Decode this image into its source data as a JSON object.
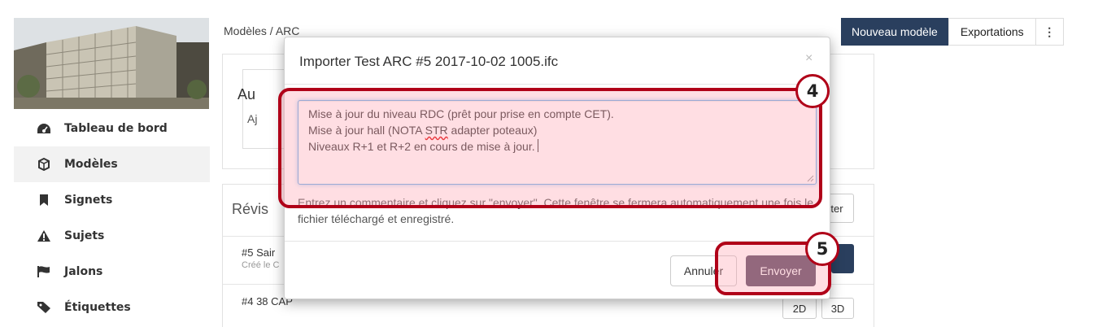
{
  "sidebar": {
    "items": [
      {
        "label": "Tableau de bord",
        "icon": "dashboard-icon"
      },
      {
        "label": "Modèles",
        "icon": "cube-icon"
      },
      {
        "label": "Signets",
        "icon": "bookmark-icon"
      },
      {
        "label": "Sujets",
        "icon": "warning-icon"
      },
      {
        "label": "Jalons",
        "icon": "flag-icon"
      },
      {
        "label": "Étiquettes",
        "icon": "tag-icon"
      }
    ],
    "active_index": 1
  },
  "header": {
    "breadcrumb": "Modèles / ARC",
    "new_model": "Nouveau modèle",
    "exports": "Exportations",
    "more": "⋮"
  },
  "background": {
    "panel_title_partial": "Au",
    "panel_sub_partial": "Aj",
    "revisions_title_partial": "Révis",
    "import_button_partial": "ter",
    "rows": [
      {
        "title_partial": "#5 Sair",
        "meta_partial": "Créé le C"
      },
      {
        "title_partial": "#4 38 CAP"
      }
    ],
    "btn_2d": "2D",
    "btn_3d": "3D"
  },
  "modal": {
    "title": "Importer Test ARC #5 2017-10-02 1005.ifc",
    "close": "×",
    "comment_lines": [
      "Mise à jour du niveau RDC (prêt pour prise en compte CET).",
      "Mise à jour hall (NOTA ",
      "Niveaux R+1 et R+2 en cours de mise à jour."
    ],
    "comment_misspelled": "STR",
    "comment_line2_rest": " adapter poteaux)",
    "help_text": "Entrez un commentaire et cliquez sur \"envoyer\". Cette fenêtre se fermera automatiquement une fois le fichier téléchargé et enregistré.",
    "cancel": "Annuler",
    "send": "Envoyer"
  },
  "annotations": {
    "step4": "4",
    "step5": "5",
    "color": "#b00018"
  },
  "colors": {
    "primary_dark": "#2a3f5e",
    "send_button": "#5a4a63",
    "focus_blue": "#66afe9"
  }
}
